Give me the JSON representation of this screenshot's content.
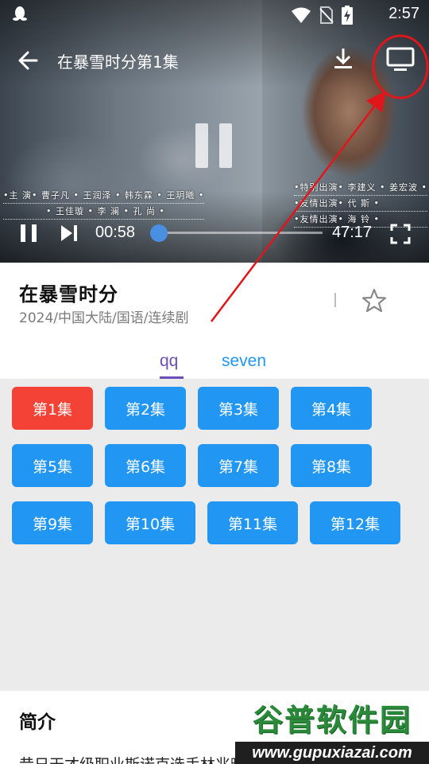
{
  "status_bar": {
    "time": "2:57"
  },
  "player": {
    "title": "在暴雪时分第1集",
    "current_time": "00:58",
    "total_time": "47:17",
    "progress": 0.02,
    "credits_left": [
      "•主 演• 曹子凡 • 王润泽 • 韩东霖 • 王玥曦 •",
      "• 王佳璇 • 李 澜 • 孔 尚 •"
    ],
    "credits_right": [
      "•特别出演• 李建义 • 姜宏波 •",
      "•友情出演• 代 斯 •",
      "•友情出演• 海 铃 •"
    ]
  },
  "show": {
    "title": "在暴雪时分",
    "meta": "2024/中国大陆/国语/连续剧"
  },
  "sources": [
    {
      "label": "qq",
      "active": true
    },
    {
      "label": "seven",
      "active": false
    }
  ],
  "episodes": [
    "第1集",
    "第2集",
    "第3集",
    "第4集",
    "第5集",
    "第6集",
    "第7集",
    "第8集",
    "第9集",
    "第10集",
    "第11集",
    "第12集"
  ],
  "active_episode": 0,
  "intro": {
    "heading": "简介",
    "text": "昔日天才级职业斯诺克选手林兆旸后来幻想"
  },
  "watermark": {
    "name": "谷普软件园",
    "url": "www.gupuxiazai.com"
  },
  "colors": {
    "accent_blue": "#2196f3",
    "active_red": "#f44336",
    "tab_purple": "#6b4fbb",
    "annotation_red": "#e0161b"
  }
}
